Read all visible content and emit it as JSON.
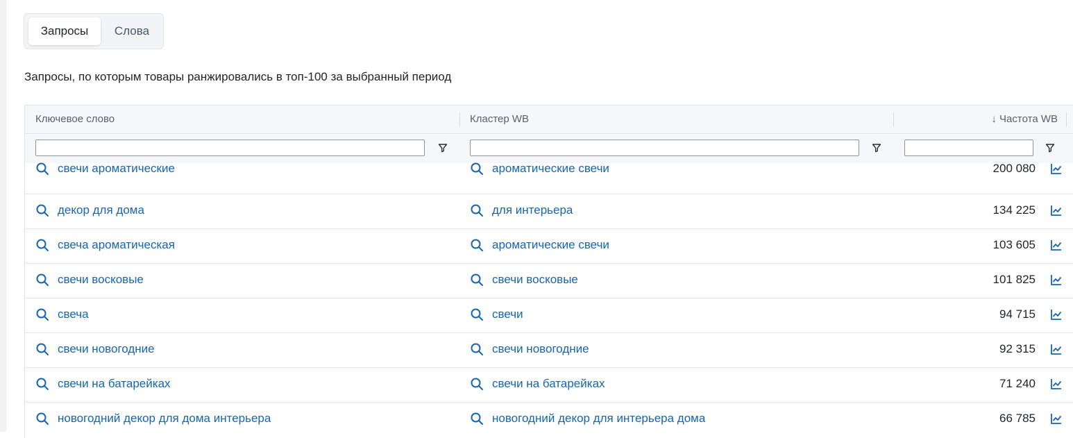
{
  "tabs": [
    {
      "label": "Запросы",
      "active": true
    },
    {
      "label": "Слова",
      "active": false
    }
  ],
  "subtitle": "Запросы, по которым товары ранжировались в топ-100 за выбранный период",
  "table": {
    "columns": {
      "keyword": "Ключевое слово",
      "cluster": "Кластер WB",
      "frequency": "↓ Частота WB"
    },
    "rows": [
      {
        "keyword": "свечи ароматические",
        "cluster": "ароматические свечи",
        "frequency": "200 080"
      },
      {
        "keyword": "декор для дома",
        "cluster": "для интерьера",
        "frequency": "134 225"
      },
      {
        "keyword": "свеча ароматическая",
        "cluster": "ароматические свечи",
        "frequency": "103 605"
      },
      {
        "keyword": "свечи восковые",
        "cluster": "свечи восковые",
        "frequency": "101 825"
      },
      {
        "keyword": "свеча",
        "cluster": "свечи",
        "frequency": "94 715"
      },
      {
        "keyword": "свечи новогодние",
        "cluster": "свечи новогодние",
        "frequency": "92 315"
      },
      {
        "keyword": "свечи на батарейках",
        "cluster": "свечи на батарейках",
        "frequency": "71 240"
      },
      {
        "keyword": "новогодний декор для дома интерьера",
        "cluster": "новогодний декор для интерьера дома",
        "frequency": "66 785"
      }
    ]
  },
  "colors": {
    "link": "#1565b0",
    "header_bg": "#f6f7f9",
    "border": "#e3e5e8"
  },
  "icons": {
    "row_search": "search-icon",
    "row_trend": "trend-chart-icon",
    "filter": "filter-icon"
  }
}
